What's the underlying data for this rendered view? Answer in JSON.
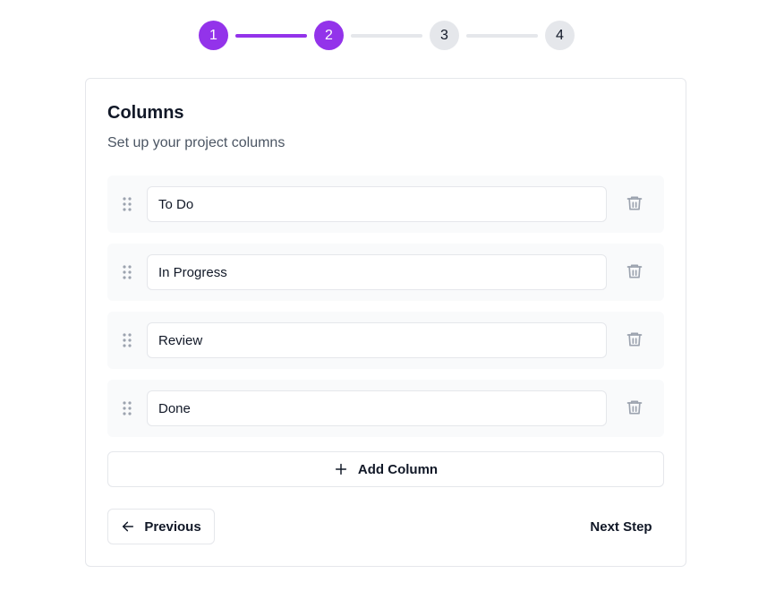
{
  "stepper": {
    "steps": [
      {
        "label": "1",
        "state": "done"
      },
      {
        "label": "2",
        "state": "active"
      },
      {
        "label": "3",
        "state": "pending"
      },
      {
        "label": "4",
        "state": "pending"
      }
    ]
  },
  "card": {
    "title": "Columns",
    "subtitle": "Set up your project columns"
  },
  "columns": [
    {
      "value": "To Do"
    },
    {
      "value": "In Progress"
    },
    {
      "value": "Review"
    },
    {
      "value": "Done"
    }
  ],
  "actions": {
    "add_column_label": "Add Column",
    "previous_label": "Previous",
    "next_label": "Next Step"
  },
  "icons": {
    "drag": "grip-vertical-icon",
    "delete": "trash-icon",
    "add": "plus-icon",
    "back": "arrow-left-icon"
  },
  "colors": {
    "accent": "#9333ea",
    "inactive_step": "#e5e7eb",
    "row_background": "#f9fafb",
    "icon_gray": "#9ca3af"
  }
}
